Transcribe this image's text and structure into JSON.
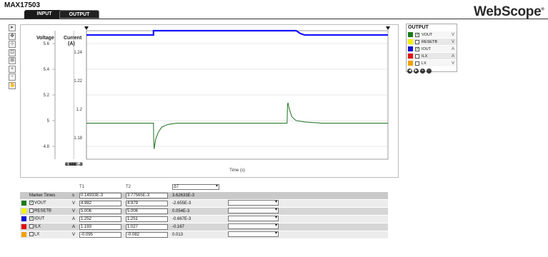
{
  "app": {
    "title": "MAX17503",
    "brand": "WebScope",
    "brand_mark": "®"
  },
  "tabs": [
    {
      "label": "INPUT",
      "active": false
    },
    {
      "label": "OUTPUT",
      "active": true
    }
  ],
  "toolbar": [
    {
      "icon": "select-icon",
      "glyph": "▸"
    },
    {
      "icon": "pan-icon",
      "glyph": "✥"
    },
    {
      "icon": "measure-icon",
      "glyph": "⊹"
    },
    {
      "icon": "zoom-box-icon",
      "glyph": "⊡"
    },
    {
      "icon": "zoom-region-icon",
      "glyph": "⊞"
    },
    {
      "icon": "zoom-in-icon",
      "glyph": "+"
    },
    {
      "icon": "zoom-out-icon",
      "glyph": "−"
    },
    {
      "icon": "hand-icon",
      "glyph": "✋"
    }
  ],
  "plot": {
    "axis_left_label": "Voltage",
    "axis_right_label": "Current",
    "axis_right_unit": "(A)",
    "voltage_ticks": [
      "5.6",
      "5.4",
      "5.2",
      "5",
      "4.8"
    ],
    "current_ticks": [
      "1.24",
      "1.22",
      "1.2",
      "1.18"
    ],
    "x_ticks": [
      "0.149E-3",
      "0.541E-3",
      "0.932E-3",
      "1.324E-3",
      "1.716E-3",
      "2.107E-3",
      "2.499E-3",
      "2.89E-3",
      "3.282E-3",
      "3.673E-3"
    ],
    "x_label": "Time (s)",
    "colors": {
      "voltage": "#2e7d32",
      "current": "#1515ff",
      "grid": "#d0d0d0"
    }
  },
  "chart_data": {
    "type": "line",
    "xlabel": "Time (s)",
    "ylabel": "Voltage",
    "y2label": "Current (A)",
    "xlim": [
      0.149,
      3.673
    ],
    "x_unit": "E-3 s",
    "ylim": [
      4.7,
      5.7
    ],
    "y2lim": [
      1.165,
      1.255
    ],
    "series": [
      {
        "name": "VOUT",
        "axis": "voltage",
        "color": "#2e7d32",
        "x": [
          0.149,
          0.932,
          0.935,
          0.94,
          0.96,
          0.99,
          1.03,
          1.1,
          1.2,
          1.4,
          2.494,
          2.499,
          2.505,
          2.52,
          2.55,
          2.6,
          2.7,
          2.9,
          3.673
        ],
        "y": [
          4.98,
          4.98,
          4.87,
          4.78,
          4.86,
          4.91,
          4.95,
          4.97,
          4.98,
          4.98,
          4.98,
          5.12,
          5.14,
          5.09,
          5.03,
          5.0,
          4.99,
          4.98,
          4.98
        ]
      },
      {
        "name": "IOUT",
        "axis": "current",
        "color": "#1515ff",
        "x": [
          0.149,
          0.932,
          0.932,
          0.94,
          1.5,
          2.498,
          2.499,
          2.501,
          2.52,
          2.55,
          2.6,
          2.65,
          2.7,
          2.8,
          3.0,
          3.673
        ],
        "y": [
          1.252,
          1.252,
          1.27,
          1.27,
          1.27,
          1.27,
          1.268,
          1.264,
          1.262,
          1.258,
          1.255,
          1.253,
          1.252,
          1.252,
          1.252,
          1.252
        ]
      }
    ],
    "markers": {
      "T1": 0.149,
      "T2": 3.673
    }
  },
  "output_panel": {
    "title": "OUTPUT",
    "items": [
      {
        "label": "VOUT",
        "unit": "V",
        "color": "#1a7a1a",
        "checked": true
      },
      {
        "label": "RESETB",
        "unit": "V",
        "color": "#f2f200",
        "checked": false
      },
      {
        "label": "IOUT",
        "unit": "A",
        "color": "#1010d0",
        "checked": true
      },
      {
        "label": "ILX",
        "unit": "A",
        "color": "#e01010",
        "checked": false
      },
      {
        "label": "LX",
        "unit": "V",
        "color": "#f0a000",
        "checked": false
      }
    ],
    "buttons": [
      "◀",
      "▶",
      "+",
      "−"
    ]
  },
  "table": {
    "headers": {
      "t1": "T1",
      "t2": "T2",
      "dt": "ΔT"
    },
    "marker_label": "Marker Times",
    "marker_unit": "s",
    "marker_t1": "0.14933E-3",
    "marker_t2": "3.77565E-3",
    "marker_dt": "3.62633E-3",
    "rows": [
      {
        "label": "VOUT",
        "unit": "V",
        "t1": "4.982",
        "t2": "4.979",
        "dt": "-2.655E-3",
        "color": "#1a7a1a",
        "checked": true
      },
      {
        "label": "RESETB",
        "unit": "V",
        "t1": "5.006",
        "t2": "5.006",
        "dt": "0.054E-3",
        "color": "#f2f200",
        "checked": false
      },
      {
        "label": "IOUT",
        "unit": "A",
        "t1": "1.252",
        "t2": "1.251",
        "dt": "-0.667E-3",
        "color": "#1010d0",
        "checked": true
      },
      {
        "label": "ILX",
        "unit": "A",
        "t1": "1.193",
        "t2": "1.027",
        "dt": "-0.167",
        "color": "#e01010",
        "checked": false
      },
      {
        "label": "LX",
        "unit": "V",
        "t1": "-0.095",
        "t2": "-0.082",
        "dt": "0.013",
        "color": "#f0a000",
        "checked": false
      }
    ]
  }
}
